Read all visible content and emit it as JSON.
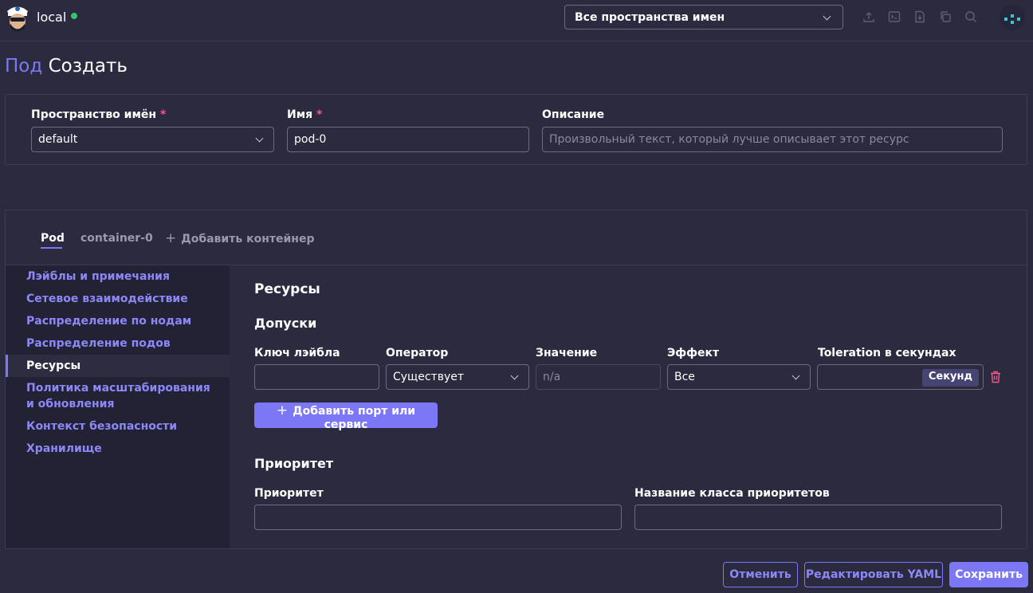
{
  "header": {
    "cluster_name": "local",
    "namespace_select": "Все пространства имен",
    "icons": [
      "upload-icon",
      "terminal-icon",
      "import-file-icon",
      "copy-icon",
      "search-icon"
    ],
    "colors": {
      "accent": "#7c78f5",
      "status_ok": "#35c46a",
      "required": "#ef5a8a"
    }
  },
  "page": {
    "title_resource": "Под",
    "title_action": "Создать"
  },
  "metadata": {
    "namespace": {
      "label": "Пространство имён",
      "required_mark": "*",
      "value": "default"
    },
    "name": {
      "label": "Имя",
      "required_mark": "*",
      "value": "pod-0"
    },
    "description": {
      "label": "Описание",
      "placeholder": "Произвольный текст, который лучше описывает этот ресурс"
    }
  },
  "tabs": {
    "pod": "Pod",
    "container": "container-0",
    "add": "Добавить контейнер"
  },
  "sidenav": {
    "items": [
      "Лэйблы и примечания",
      "Сетевое взаимодействие",
      "Распределение по нодам",
      "Распределение подов",
      "Ресурсы",
      "Политика масштабирования и обновления",
      "Контекст безопасности",
      "Хранилище"
    ],
    "active": "Ресурсы"
  },
  "content": {
    "section_title": "Ресурсы",
    "tolerations": {
      "title": "Допуски",
      "col_key": "Ключ лэйбла",
      "col_operator": "Оператор",
      "col_value": "Значение",
      "col_effect": "Эффект",
      "col_seconds": "Toleration в секундах",
      "operator_value": "Существует",
      "value_placeholder": "n/a",
      "effect_value": "Все",
      "seconds_unit": "Секунд",
      "add_button": "Добавить порт или сервис"
    },
    "priority": {
      "title": "Приоритет",
      "priority_label": "Приоритет",
      "class_label": "Название класса приоритетов"
    }
  },
  "footer": {
    "cancel": "Отменить",
    "edit_yaml": "Редактировать YAML",
    "save": "Сохранить"
  }
}
